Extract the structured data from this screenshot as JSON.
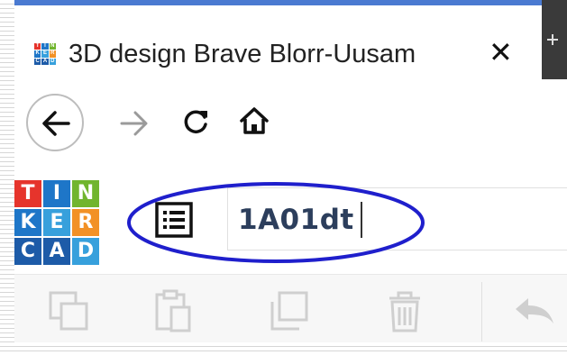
{
  "browser": {
    "tab": {
      "title": "3D design Brave Blorr-Uusam",
      "close_label": "✕",
      "favicon_letters": [
        "T",
        "I",
        "N",
        "K",
        "E",
        "R",
        "C",
        "A",
        "D"
      ]
    },
    "nav": {
      "back_icon": "back-arrow-icon",
      "forward_icon": "forward-arrow-icon",
      "reload_icon": "reload-icon",
      "home_icon": "home-icon"
    }
  },
  "app": {
    "logo_letters": [
      "T",
      "I",
      "N",
      "K",
      "E",
      "R",
      "C",
      "A",
      "D"
    ],
    "design_name": "1A01dt",
    "list_icon": "design-list-icon",
    "highlight_color": "#1f1fcc"
  },
  "toolbar": {
    "tools": [
      "copy-icon",
      "paste-icon",
      "duplicate-icon",
      "delete-icon",
      "undo-icon"
    ]
  }
}
